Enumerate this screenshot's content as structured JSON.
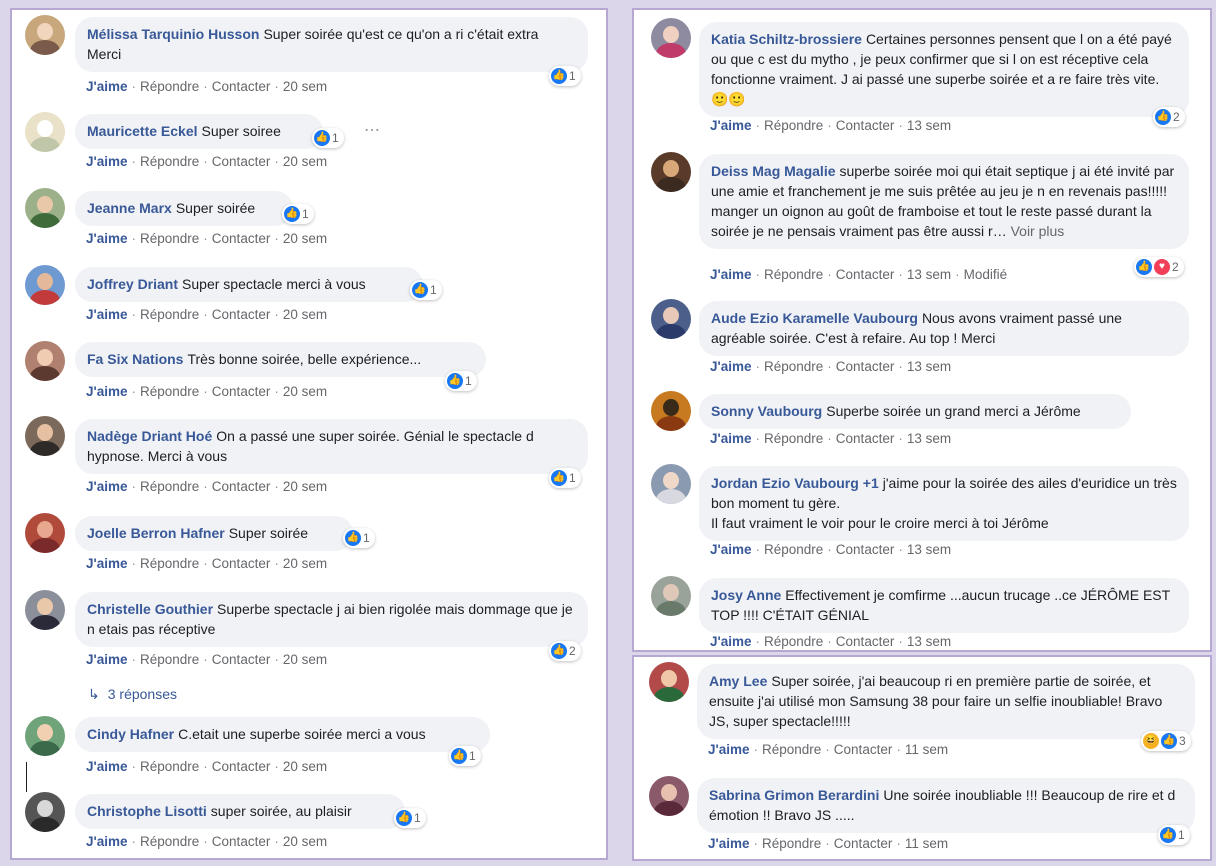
{
  "actions": {
    "like": "J'aime",
    "reply": "Répondre",
    "contact": "Contacter",
    "modified": "Modifié"
  },
  "colors": {
    "author": "#385898",
    "bubble": "#f0f2f5",
    "like_blue": "#1877f2",
    "love_red": "#f33e58",
    "haha_yellow": "#f7b125"
  },
  "left_comments": [
    {
      "author": "Mélissa Tarquinio Husson",
      "text": "Super soirée qu'est ce qu'on a ri c'était extra Merci",
      "time": "20 sem",
      "reaction_count": "1",
      "avatar_bg": "#c9a77d"
    },
    {
      "author": "Mauricette Eckel",
      "text": "Super soiree",
      "time": "20 sem",
      "reaction_count": "1",
      "avatar_bg": "#e9e2c8",
      "more": "⋯"
    },
    {
      "author": "Jeanne Marx",
      "text": "Super soirée",
      "time": "20 sem",
      "reaction_count": "1",
      "avatar_bg": "#9cb08a"
    },
    {
      "author": "Joffrey Driant",
      "text": "Super spectacle merci à vous",
      "time": "20 sem",
      "reaction_count": "1",
      "avatar_bg": "#6f9ad1"
    },
    {
      "author": "Fa Six Nations",
      "text": "Très bonne soirée, belle expérience...",
      "time": "20 sem",
      "reaction_count": "1",
      "avatar_bg": "#b08070"
    },
    {
      "author": "Nadège Driant Hoé",
      "text": "On a passé une super soirée. Génial le spectacle d hypnose. Merci à vous",
      "time": "20 sem",
      "reaction_count": "1",
      "avatar_bg": "#7b6a5c"
    },
    {
      "author": "Joelle Berron Hafner",
      "text": "Super soirée",
      "time": "20 sem",
      "reaction_count": "1",
      "avatar_bg": "#b04a3a"
    },
    {
      "author": "Christelle Gouthier",
      "text": "Superbe spectacle j ai bien rigolée mais dommage que je n etais pas réceptive",
      "time": "20 sem",
      "reaction_count": "2",
      "avatar_bg": "#8a8f9a",
      "replies": "3 réponses"
    },
    {
      "author": "Cindy Hafner",
      "text": "C.etait une superbe soirée merci a vous",
      "time": "20 sem",
      "reaction_count": "1",
      "avatar_bg": "#6fa37a"
    },
    {
      "author": "Christophe Lisotti",
      "text": "super soirée, au plaisir",
      "time": "20 sem",
      "reaction_count": "1",
      "avatar_bg": "#555555"
    }
  ],
  "right_comments": [
    {
      "author": "Katia Schiltz-brossiere",
      "text": "Certaines personnes pensent que l on a été payé ou que c est du mytho , je peux confirmer que si l on est réceptive cela fonctionne vraiment. J ai passé une superbe soirée et a re faire très vite. 🙂🙂",
      "time": "13 sem",
      "reaction_count": "2",
      "avatar_bg": "#8e8aa0"
    },
    {
      "author": "Deiss Mag Magalie",
      "text": "superbe soirée moi qui était septique j ai été invité par une amie et franchement je me suis prêtée au jeu je n en revenais pas!!!!! manger un oignon au goût de framboise et tout le reste passé durant la soirée je ne pensais vraiment pas être aussi r…",
      "see_more": "Voir plus",
      "time": "13 sem",
      "modified": true,
      "reaction_count": "2",
      "avatar_bg": "#5a3b2a"
    },
    {
      "author": "Aude Ezio Karamelle Vaubourg",
      "text": "Nous avons vraiment passé une agréable soirée. C'est à refaire. Au top ! Merci",
      "time": "13 sem",
      "avatar_bg": "#4c5f8a"
    },
    {
      "author": "Sonny Vaubourg",
      "text": "Superbe soirée un grand merci a Jérôme",
      "time": "13 sem",
      "avatar_bg": "#c87a20"
    },
    {
      "author": "Jordan Ezio Vaubourg",
      "plus": "+1",
      "text": "j'aime pour la soirée des ailes d'euridice un très bon moment tu gère.",
      "text2": "Il faut vraiment le voir pour le croire merci à toi Jérôme",
      "time": "13 sem",
      "avatar_bg": "#8a9ab0"
    },
    {
      "author": "Josy Anne",
      "text": "Effectivement je comfirme ...aucun trucage ..ce JÉRÔME EST TOP !!!! C'ÉTAIT GÉNIAL",
      "time": "13 sem",
      "avatar_bg": "#9aa39a"
    }
  ],
  "bottom_comments": [
    {
      "author": "Amy Lee",
      "text": "Super soirée, j'ai beaucoup ri en première partie de soirée, et ensuite j'ai utilisé mon Samsung 38 pour faire un selfie inoubliable! Bravo JS, super spectacle!!!!!",
      "time": "11 sem",
      "reaction_count": "3",
      "avatar_bg": "#b24a4a"
    },
    {
      "author": "Sabrina Grimon Berardini",
      "text": "Une soirée inoubliable !!! Beaucoup de rire et d émotion !! Bravo JS .....",
      "time": "11 sem",
      "reaction_count": "1",
      "avatar_bg": "#8a5a6a"
    }
  ]
}
